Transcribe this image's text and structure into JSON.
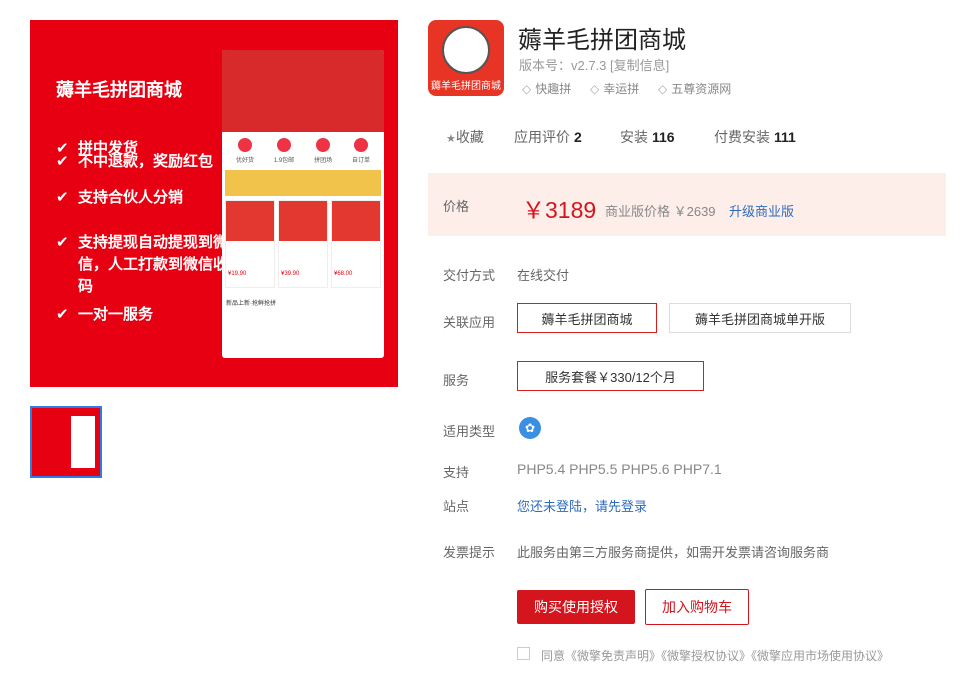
{
  "banner": {
    "title": "薅羊毛拼团商城",
    "features": [
      "拼中发货",
      "不中退款，奖励红包",
      "支持合伙人分销",
      "支持提现自动提现到微信，人工打款到微信收款码",
      "一对一服务"
    ],
    "check_glyph": "✔",
    "phone": {
      "icons": [
        "优好货",
        "1.9包邮",
        "拼团场",
        "自订单"
      ],
      "prices": [
        "¥19.90",
        "¥39.90",
        "¥68.00"
      ],
      "footer": "新品上新·抢鲜抢拼"
    }
  },
  "app": {
    "title": "薅羊毛拼团商城",
    "logo_caption": "薅羊毛拼团商城",
    "version": "版本号：v2.7.3 [复制信息]",
    "tags": [
      "快趣拼",
      "幸运拼",
      "五尊资源网"
    ]
  },
  "stats": {
    "favorite": "收藏",
    "rating_label": "应用评价",
    "rating_value": "2",
    "install_label": "安装",
    "install_value": "116",
    "paid_label": "付费安装",
    "paid_value": "111"
  },
  "price": {
    "label": "价格",
    "value": "￥3189",
    "commercial_label": "商业版价格 ￥2639",
    "upgrade_link": "升级商业版"
  },
  "delivery": {
    "label": "交付方式",
    "value": "在线交付"
  },
  "related": {
    "label": "关联应用",
    "options": [
      "薅羊毛拼团商城",
      "薅羊毛拼团商城单开版"
    ]
  },
  "service": {
    "label": "服务",
    "option": "服务套餐￥330/12个月"
  },
  "type": {
    "label": "适用类型"
  },
  "support": {
    "label": "支持",
    "value": "PHP5.4 PHP5.5 PHP5.6 PHP7.1"
  },
  "site": {
    "label": "站点",
    "value": "您还未登陆，请先登录"
  },
  "invoice": {
    "label": "发票提示",
    "value": "此服务由第三方服务商提供，如需开发票请咨询服务商"
  },
  "actions": {
    "buy": "购买使用授权",
    "cart": "加入购物车"
  },
  "agree": "同意《微擎免责声明》《微擎授权协议》《微擎应用市场使用协议》",
  "colors": {
    "brand_red": "#d4151d",
    "banner_red": "#e60012",
    "price_bg": "#fdeeea",
    "link_blue": "#2f6bbd"
  }
}
